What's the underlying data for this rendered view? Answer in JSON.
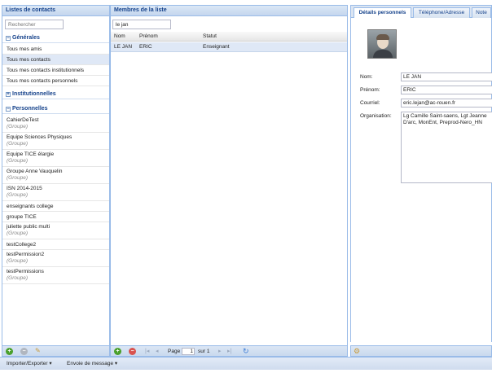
{
  "left": {
    "header": "Listes de contacts",
    "search_placeholder": "Rechercher",
    "sections": {
      "generales": {
        "label": "Générales",
        "toggle": "−"
      },
      "institutionnelles": {
        "label": "Institutionnelles",
        "toggle": "+"
      },
      "personnelles": {
        "label": "Personnelles",
        "toggle": "−"
      }
    },
    "general_items": [
      "Tous mes amis",
      "Tous mes contacts",
      "Tous mes contacts institutionnels",
      "Tous mes contacts personnels"
    ],
    "groups": [
      {
        "name": "CahierDeTest",
        "type": "(Groupe)"
      },
      {
        "name": "Equipe Sciences Physiques",
        "type": "(Groupe)"
      },
      {
        "name": "Equipe TICE élargie",
        "type": "(Groupe)"
      },
      {
        "name": "Groupe Anne Vauquelin",
        "type": "(Groupe)"
      },
      {
        "name": "ISN 2014-2015",
        "type": "(Groupe)"
      },
      {
        "name": "enseignants college",
        "type": ""
      },
      {
        "name": "groupe TICE",
        "type": ""
      },
      {
        "name": "juliette public multi",
        "type": "(Groupe)"
      },
      {
        "name": "testCollege2",
        "type": ""
      },
      {
        "name": "testPermission2",
        "type": "(Groupe)"
      },
      {
        "name": "testPermissions",
        "type": "(Groupe)"
      }
    ]
  },
  "middle": {
    "header": "Membres de la liste",
    "search_value": "le jan",
    "columns": [
      "Nom",
      "Prénom",
      "Statut"
    ],
    "rows": [
      {
        "nom": "LE JAN",
        "prenom": "ERIC",
        "statut": "Enseignant"
      }
    ]
  },
  "right": {
    "tabs": [
      "Détails personnels",
      "Téléphone/Adresse",
      "Note"
    ],
    "fields": {
      "nom_label": "Nom:",
      "nom": "LE JAN",
      "prenom_label": "Prénom:",
      "prenom": "ERIC",
      "courriel_label": "Courriel:",
      "courriel": "eric.lejan@ac-rouen.fr",
      "organisation_label": "Organisation:",
      "organisation": "Lg Camille Saint-saens, Lgt Jeanne D'arc, MonEnt, Preprod-Nero_HN"
    }
  },
  "pager": {
    "page_label": "Page",
    "page_value": "1",
    "of_label": "sur 1"
  },
  "bottom": {
    "import_export": "Importer/Exporter ▾",
    "send_message": "Envoie de message ▾"
  },
  "colors": {
    "accent": "#15428b",
    "border": "#99bbe8",
    "selected": "#dfe8f6"
  }
}
